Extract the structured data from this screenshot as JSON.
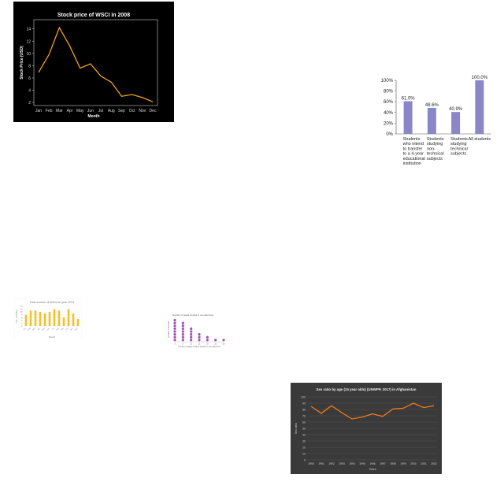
{
  "colors": {
    "stock_bg": "#000000",
    "stock_line": "#f0a020",
    "students_bar": "#8a86c8",
    "births_bar": "#f2c12e",
    "dots": "#a052b0",
    "sex_bg": "#3a3a3a",
    "sex_line": "#f07a1a"
  },
  "chart_data": [
    {
      "type": "line",
      "title": "Stock price of WSCI in 2008",
      "xlabel": "Month",
      "ylabel": "Stock Price (USD)",
      "categories": [
        "Jan",
        "Feb",
        "Mar",
        "Apr",
        "May",
        "Jun",
        "Jul",
        "Aug",
        "Sep",
        "Oct",
        "Nov",
        "Dec"
      ],
      "values": [
        6.9,
        9.8,
        14.2,
        11.2,
        7.6,
        8.3,
        6.3,
        5.3,
        3.0,
        3.3,
        2.8,
        2.1
      ],
      "ylim": [
        1.5,
        15.5
      ],
      "yticks": [
        2,
        4,
        6,
        8,
        10,
        12,
        14
      ],
      "grid": false
    },
    {
      "type": "bar",
      "categories": [
        [
          "Students",
          "who intend",
          "to transfer",
          "to a 4-year",
          "educational",
          "institution"
        ],
        [
          "Students",
          "studying",
          "non-",
          "technical",
          "subjects"
        ],
        [
          "Students",
          "studying",
          "technical",
          "subjects"
        ],
        [
          "All students"
        ]
      ],
      "values": [
        61.0,
        48.6,
        40.9,
        100.0
      ],
      "data_labels": [
        "61.0%",
        "48.6%",
        "40.9%",
        "100.0%"
      ],
      "ylim": [
        0,
        100
      ],
      "yticks": [
        "0%",
        "20%",
        "40%",
        "60%",
        "80%",
        "100%"
      ],
      "grid": false
    },
    {
      "type": "bar",
      "title": "Total number of births for year 2014",
      "xlabel": "Month",
      "ylabel": "No. of births",
      "categories": [
        "Jan",
        "Feb",
        "Mar",
        "Apr",
        "May",
        "Jun",
        "Jul",
        "Aug",
        "Sep",
        "Oct",
        "Nov",
        "Dec"
      ],
      "values": [
        8,
        11,
        11,
        10,
        9,
        10,
        12,
        11,
        6,
        12,
        9,
        5
      ],
      "ylim": [
        0,
        14
      ],
      "grid": true
    },
    {
      "type": "scatter",
      "title": "Number of pages studied in one afternoon",
      "xlabel": "Number of pages read by student in one afternoon",
      "ylabel": "Number of students",
      "categories": [
        "0",
        "5",
        "10",
        "15",
        "20",
        "25",
        "30"
      ],
      "values": [
        8,
        7,
        5,
        3,
        2,
        1,
        1
      ]
    },
    {
      "type": "line",
      "title": "Sex ratio by age (15 year olds) (UNWPP, 2017) in Afghanistan",
      "xlabel": "Years",
      "ylabel": "Sex ratio",
      "categories": [
        "1990",
        "1991",
        "1992",
        "1993",
        "1994",
        "1995",
        "1996",
        "1997",
        "1998",
        "1999",
        "2000",
        "2001",
        "2002"
      ],
      "values": [
        85,
        74,
        86,
        75,
        65,
        68,
        73,
        69,
        81,
        82,
        90,
        83,
        86
      ],
      "ylim": [
        0,
        100
      ],
      "yticks": [
        0,
        10,
        20,
        30,
        40,
        50,
        60,
        70,
        80,
        90,
        100
      ],
      "grid": true
    }
  ]
}
